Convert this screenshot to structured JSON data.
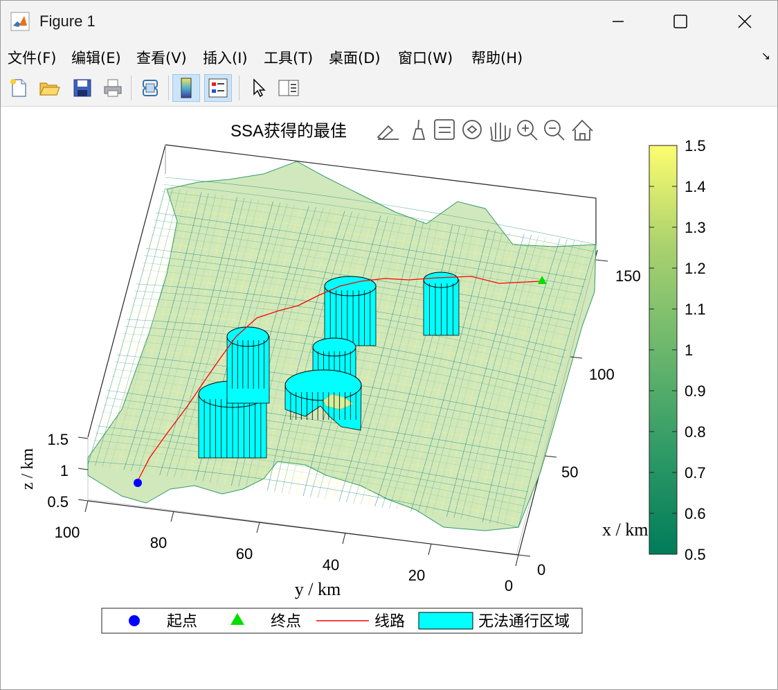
{
  "window": {
    "title": "Figure 1",
    "minimize_icon": "minimize-icon",
    "maximize_icon": "maximize-icon",
    "close_icon": "close-icon"
  },
  "menu": {
    "items": [
      "文件(F)",
      "编辑(E)",
      "查看(V)",
      "插入(I)",
      "工具(T)",
      "桌面(D)",
      "窗口(W)",
      "帮助(H)"
    ],
    "dock_icon": "dock-arrow-icon"
  },
  "toolbar": {
    "icons": [
      "new-figure-icon",
      "open-file-icon",
      "save-icon",
      "print-icon",
      "link-plot-icon",
      "colorbar-icon",
      "legend-icon",
      "pointer-icon",
      "property-inspector-icon"
    ]
  },
  "axes_toolbar": {
    "icons": [
      "brush-edit-icon",
      "data-brush-icon",
      "datatip-icon",
      "rotate-3d-icon",
      "pan-icon",
      "zoom-in-icon",
      "zoom-out-icon",
      "home-icon"
    ]
  },
  "chart_data": {
    "type": "surface",
    "title": "SSA获得的最佳",
    "xlabel": "x / km",
    "ylabel": "y / km",
    "zlabel": "z / km",
    "x_ticks": [
      0,
      50,
      100,
      150
    ],
    "y_ticks": [
      0,
      20,
      40,
      60,
      80,
      100
    ],
    "z_ticks": [
      0.5,
      1,
      1.5
    ],
    "colorbar": {
      "ticks": [
        0.5,
        0.6,
        0.7,
        0.8,
        0.9,
        1,
        1.1,
        1.2,
        1.3,
        1.4,
        1.5
      ],
      "colormap": [
        "#007c5a",
        "#2f9a66",
        "#6bb76d",
        "#a9d16e",
        "#fdfd6f"
      ]
    },
    "legend": {
      "placement": "bottom",
      "entries": [
        {
          "label": "起点",
          "marker": "circle",
          "color": "#0000ff"
        },
        {
          "label": "终点",
          "marker": "triangle",
          "color": "#00e000"
        },
        {
          "label": "线路",
          "marker": "line",
          "color": "#ff0000"
        },
        {
          "label": "无法通行区域",
          "marker": "patch",
          "color": "#00ffff"
        }
      ]
    },
    "start_point": {
      "label": "起点",
      "color": "#0000ff"
    },
    "end_point": {
      "label": "终点",
      "color": "#00e000"
    },
    "route": {
      "label": "线路",
      "color": "#ff0000"
    },
    "obstacles": {
      "label": "无法通行区域",
      "count": 6,
      "color": "#00ffff"
    }
  }
}
